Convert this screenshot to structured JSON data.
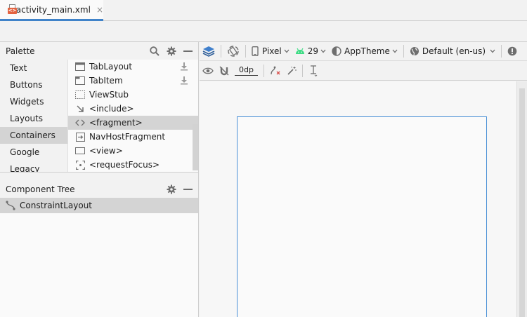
{
  "editor": {
    "tab_label": "activity_main.xml",
    "tab_close": "×",
    "file_icon_text": "<>"
  },
  "palette": {
    "title": "Palette",
    "categories": [
      "Text",
      "Buttons",
      "Widgets",
      "Layouts",
      "Containers",
      "Google",
      "Legacy"
    ],
    "selected_category": "Containers",
    "items": [
      {
        "label": "TabLayout",
        "icon": "tablayout-icon",
        "download": true
      },
      {
        "label": "TabItem",
        "icon": "tabitem-icon",
        "download": true
      },
      {
        "label": "ViewStub",
        "icon": "viewstub-icon",
        "download": false
      },
      {
        "label": "<include>",
        "icon": "include-icon",
        "download": false
      },
      {
        "label": "<fragment>",
        "icon": "fragment-icon",
        "download": false
      },
      {
        "label": "NavHostFragment",
        "icon": "navhostfragment-icon",
        "download": false
      },
      {
        "label": "<view>",
        "icon": "view-icon",
        "download": false
      },
      {
        "label": "<requestFocus>",
        "icon": "requestfocus-icon",
        "download": false
      }
    ],
    "selected_item": "<fragment>"
  },
  "component_tree": {
    "title": "Component Tree",
    "root": "ConstraintLayout"
  },
  "design_toolbar": {
    "device": "Pixel",
    "api": "29",
    "theme": "AppTheme",
    "locale": "Default (en-us)",
    "margin": "0dp"
  },
  "colors": {
    "accent": "#4083c9",
    "android_green": "#3ddc84",
    "selection": "#d4d4d4",
    "device_border": "#4a90d6"
  }
}
